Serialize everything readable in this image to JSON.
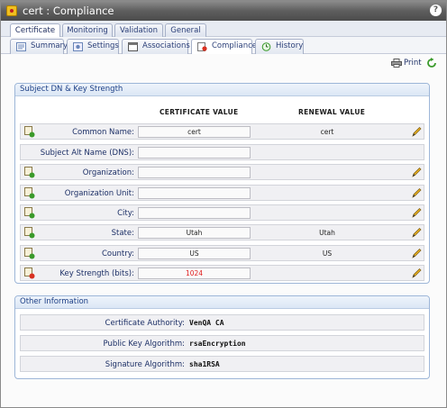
{
  "window": {
    "title": "cert : Compliance",
    "help_label": "?"
  },
  "tabs_primary": [
    {
      "label": "Certificate",
      "active": true
    },
    {
      "label": "Monitoring",
      "active": false
    },
    {
      "label": "Validation",
      "active": false
    },
    {
      "label": "General",
      "active": false
    }
  ],
  "tabs_secondary": [
    {
      "label": "Summary",
      "icon": "summary-icon",
      "active": false
    },
    {
      "label": "Settings",
      "icon": "settings-icon",
      "active": false
    },
    {
      "label": "Associations",
      "icon": "associations-icon",
      "active": false
    },
    {
      "label": "Compliance",
      "icon": "compliance-icon",
      "active": true
    },
    {
      "label": "History",
      "icon": "history-icon",
      "active": false
    }
  ],
  "toolbar": {
    "print_label": "Print",
    "refresh_icon": "refresh-icon"
  },
  "subject_panel": {
    "title": "Subject DN & Key Strength",
    "col_certificate": "CERTIFICATE VALUE",
    "col_renewal": "RENEWAL VALUE",
    "rows": [
      {
        "label": "Common Name:",
        "value": "cert",
        "renewal": "cert",
        "status": "ok",
        "editable": true
      },
      {
        "label": "Subject Alt Name (DNS):",
        "value": "",
        "renewal": "",
        "status": "none",
        "editable": false
      },
      {
        "label": "Organization:",
        "value": "",
        "renewal": "",
        "status": "ok",
        "editable": true
      },
      {
        "label": "Organization Unit:",
        "value": "",
        "renewal": "",
        "status": "ok",
        "editable": true
      },
      {
        "label": "City:",
        "value": "",
        "renewal": "",
        "status": "ok",
        "editable": true
      },
      {
        "label": "State:",
        "value": "Utah",
        "renewal": "Utah",
        "status": "ok",
        "editable": true
      },
      {
        "label": "Country:",
        "value": "US",
        "renewal": "US",
        "status": "ok",
        "editable": true
      },
      {
        "label": "Key Strength (bits):",
        "value": "1024",
        "renewal": "",
        "status": "error",
        "editable": true
      }
    ]
  },
  "other_panel": {
    "title": "Other Information",
    "rows": [
      {
        "label": "Certificate Authority:",
        "value": "VenQA CA"
      },
      {
        "label": "Public Key Algorithm:",
        "value": "rsaEncryption"
      },
      {
        "label": "Signature Algorithm:",
        "value": "sha1RSA"
      }
    ]
  },
  "colors": {
    "accent": "#1c3f86",
    "alert": "#e01c1c",
    "ok": "#3a9a2a"
  }
}
